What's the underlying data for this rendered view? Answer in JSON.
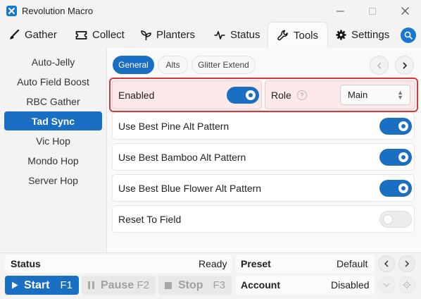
{
  "window": {
    "title": "Revolution Macro"
  },
  "tabs": [
    {
      "label": "Gather",
      "icon": "paintbrush-icon"
    },
    {
      "label": "Collect",
      "icon": "ticket-icon"
    },
    {
      "label": "Planters",
      "icon": "sprout-icon"
    },
    {
      "label": "Status",
      "icon": "pulse-icon"
    },
    {
      "label": "Tools",
      "icon": "wrench-icon",
      "active": true
    },
    {
      "label": "Settings",
      "icon": "gear-icon"
    }
  ],
  "sidebar": {
    "items": [
      {
        "label": "Auto-Jelly"
      },
      {
        "label": "Auto Field Boost"
      },
      {
        "label": "RBC Gather"
      },
      {
        "label": "Tad Sync",
        "active": true
      },
      {
        "label": "Vic Hop"
      },
      {
        "label": "Mondo Hop"
      },
      {
        "label": "Server Hop"
      }
    ]
  },
  "subtabs": [
    {
      "label": "General",
      "active": true
    },
    {
      "label": "Alts"
    },
    {
      "label": "Glitter Extend"
    }
  ],
  "settings": {
    "enabled": {
      "label": "Enabled",
      "on": true
    },
    "role": {
      "label": "Role",
      "help": "?",
      "value": "Main"
    },
    "rows": [
      {
        "label": "Use Best Pine Alt Pattern",
        "on": true
      },
      {
        "label": "Use Best Bamboo Alt Pattern",
        "on": true
      },
      {
        "label": "Use Best Blue Flower Alt Pattern",
        "on": true
      },
      {
        "label": "Reset To Field",
        "on": false
      }
    ]
  },
  "statusbar": {
    "status_label": "Status",
    "status_value": "Ready",
    "preset_label": "Preset",
    "preset_value": "Default",
    "account_label": "Account",
    "account_value": "Disabled",
    "start": {
      "label": "Start",
      "key": "F1"
    },
    "pause": {
      "label": "Pause",
      "key": "F2"
    },
    "stop": {
      "label": "Stop",
      "key": "F3"
    }
  },
  "colors": {
    "accent": "#1a6fc2",
    "highlight_border": "#d9363e",
    "highlight_fill": "#fde9e9"
  }
}
